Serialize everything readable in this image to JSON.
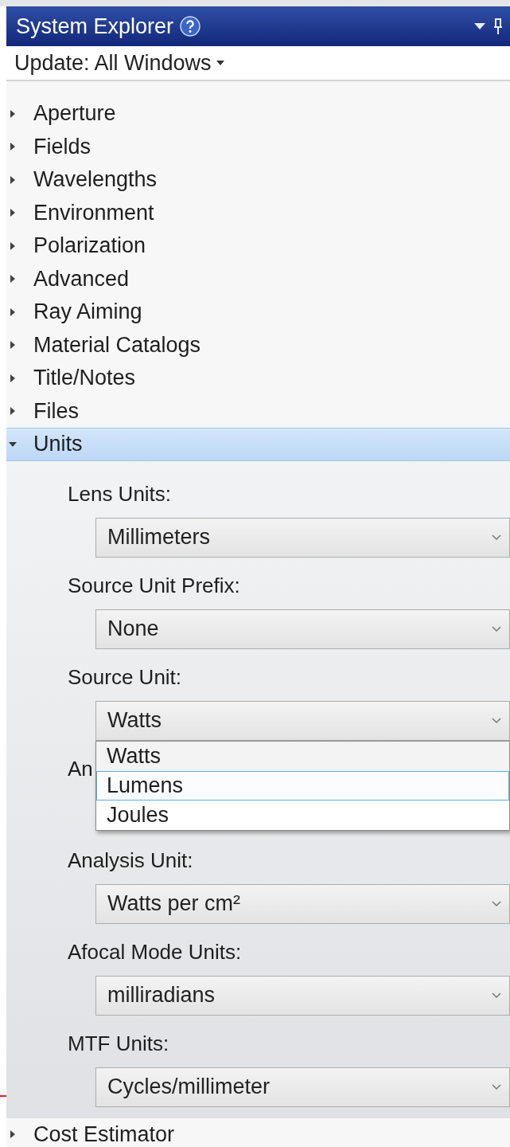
{
  "header": {
    "title": "System Explorer"
  },
  "update": {
    "label": "Update: All Windows"
  },
  "tree": [
    {
      "label": "Aperture",
      "expanded": false
    },
    {
      "label": "Fields",
      "expanded": false
    },
    {
      "label": "Wavelengths",
      "expanded": false
    },
    {
      "label": "Environment",
      "expanded": false
    },
    {
      "label": "Polarization",
      "expanded": false
    },
    {
      "label": "Advanced",
      "expanded": false
    },
    {
      "label": "Ray Aiming",
      "expanded": false
    },
    {
      "label": "Material Catalogs",
      "expanded": false
    },
    {
      "label": "Title/Notes",
      "expanded": false
    },
    {
      "label": "Files",
      "expanded": false
    },
    {
      "label": "Units",
      "expanded": true,
      "selected": true,
      "fields": [
        {
          "label": "Lens Units:",
          "value": "Millimeters"
        },
        {
          "label": "Source Unit Prefix:",
          "value": "None"
        },
        {
          "label": "Source Unit:",
          "value": "Watts",
          "options": [
            {
              "label": "Watts",
              "selected": true,
              "hovered": false
            },
            {
              "label": "Lumens",
              "selected": false,
              "hovered": true
            },
            {
              "label": "Joules",
              "selected": false,
              "hovered": false
            }
          ]
        },
        {
          "label": "An"
        },
        {
          "label": "Analysis Unit:",
          "value": "Watts per cm²"
        },
        {
          "label": "Afocal Mode Units:",
          "value": "milliradians"
        },
        {
          "label": "MTF Units:",
          "value": "Cycles/millimeter"
        }
      ]
    },
    {
      "label": "Cost Estimator",
      "expanded": false
    }
  ]
}
